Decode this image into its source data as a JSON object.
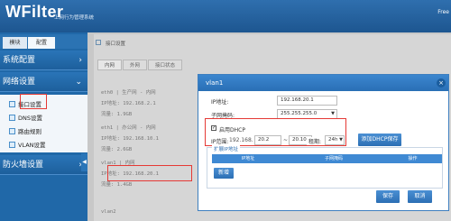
{
  "app": {
    "logo": "WFilter",
    "subtitle": "上网行为管理系统",
    "top_right": "Free"
  },
  "sidebar": {
    "tabs": [
      "模块",
      "配置"
    ],
    "sections": [
      {
        "label": "系统配置"
      },
      {
        "label": "网络设置"
      },
      {
        "label": "防火墙设置"
      }
    ],
    "sub_items": [
      {
        "label": "接口设置"
      },
      {
        "label": "DNS设置"
      },
      {
        "label": "路由规则"
      },
      {
        "label": "VLAN设置"
      }
    ],
    "collapse_glyph": "◀"
  },
  "main": {
    "breadcrumb": "接口设置",
    "tabs": [
      "内网",
      "外网",
      "接口状态"
    ],
    "cards": [
      {
        "line1": "eth0 | 生产网 - 内网",
        "line2": "IP地址: 192.168.2.1",
        "line3": "流量: 1.9GB"
      },
      {
        "line1": "eth1 | 办公网 - 内网",
        "line2": "IP地址: 192.168.10.1",
        "line3": "流量: 2.6GB"
      },
      {
        "line1": "vlan1 | 内网",
        "line2": "IP地址: 192.168.20.1",
        "line3": "流量: 1.4GB"
      },
      {
        "line1": "vlan2"
      }
    ]
  },
  "modal": {
    "title": "vlan1",
    "close": "×",
    "ip_label": "IP地址:",
    "ip_value": "192.168.20.1",
    "mask_label": "子网掩码:",
    "mask_value": "255.255.255.0",
    "dhcp_label": "启用DHCP",
    "dhcp_checked": "✓",
    "range_label": "IP范围:",
    "range_prefix": "192.168.",
    "range_start": "20.2",
    "range_sep": "~",
    "range_end": "20.100",
    "lease_label": "租期:",
    "lease_value": "24h",
    "save_dhcp_label": "添加DHCP保存",
    "ext_ip_legend": "扩展IP地址",
    "table_headers": [
      "IP地址",
      "子网掩码",
      "操作"
    ],
    "add_label": "新增",
    "save_label": "保存",
    "cancel_label": "取消"
  }
}
